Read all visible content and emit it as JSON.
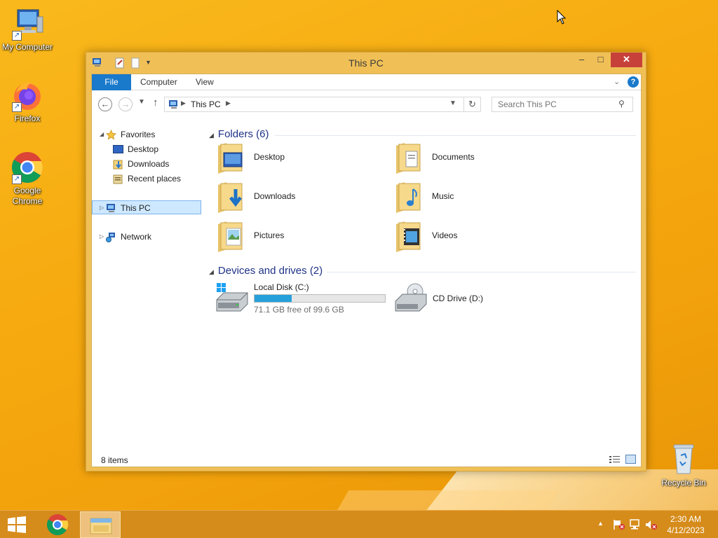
{
  "desktop": {
    "icons": [
      {
        "label": "My Computer"
      },
      {
        "label": "Firefox"
      },
      {
        "label": "Google Chrome"
      },
      {
        "label": "Recycle Bin"
      }
    ]
  },
  "window": {
    "title": "This PC",
    "controls": {
      "minimize": "–",
      "maximize": "□",
      "close": "✕"
    },
    "ribbon": {
      "tabs": [
        {
          "label": "File",
          "active": true
        },
        {
          "label": "Computer"
        },
        {
          "label": "View"
        }
      ],
      "help": "?"
    },
    "nav": {
      "back": "←",
      "forward": "→",
      "up": "↑",
      "refresh": "↻",
      "address": "This PC",
      "search_placeholder": "Search This PC"
    },
    "sidebar": {
      "favorites_label": "Favorites",
      "favorites": [
        {
          "label": "Desktop"
        },
        {
          "label": "Downloads"
        },
        {
          "label": "Recent places"
        }
      ],
      "this_pc_label": "This PC",
      "network_label": "Network"
    },
    "content": {
      "folders_header": "Folders (6)",
      "folders": [
        {
          "label": "Desktop",
          "icon": "desktop-folder-icon"
        },
        {
          "label": "Documents",
          "icon": "documents-folder-icon"
        },
        {
          "label": "Downloads",
          "icon": "downloads-folder-icon"
        },
        {
          "label": "Music",
          "icon": "music-folder-icon"
        },
        {
          "label": "Pictures",
          "icon": "pictures-folder-icon"
        },
        {
          "label": "Videos",
          "icon": "videos-folder-icon"
        }
      ],
      "devices_header": "Devices and drives (2)",
      "drives": [
        {
          "label": "Local Disk (C:)",
          "free_text": "71.1 GB free of 99.6 GB",
          "used_fraction": 0.286
        },
        {
          "label": "CD Drive (D:)"
        }
      ]
    },
    "status": {
      "items": "8 items"
    }
  },
  "taskbar": {
    "clock_time": "2:30 AM",
    "clock_date": "4/12/2023"
  },
  "colors": {
    "accent": "#1979ca",
    "desktop": "#f6a90f",
    "selection": "#cde8ff",
    "drive_bar": "#26a0da"
  }
}
